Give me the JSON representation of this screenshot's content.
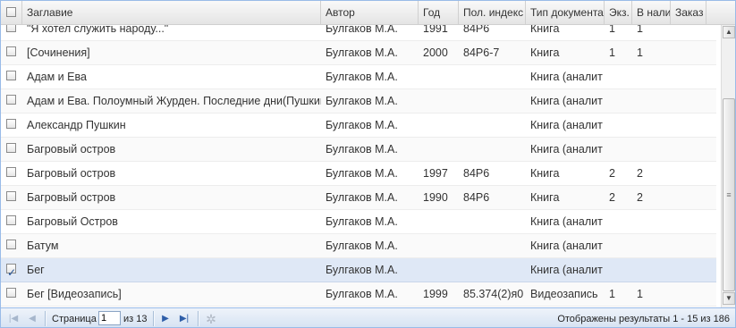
{
  "columns": [
    {
      "key": "select",
      "label": ""
    },
    {
      "key": "title",
      "label": "Заглавие"
    },
    {
      "key": "author",
      "label": "Автор"
    },
    {
      "key": "year",
      "label": "Год"
    },
    {
      "key": "index",
      "label": "Пол. индекс"
    },
    {
      "key": "doctype",
      "label": "Тип документа"
    },
    {
      "key": "copies",
      "label": "Экз."
    },
    {
      "key": "available",
      "label": "В наличии"
    },
    {
      "key": "order",
      "label": "Заказ"
    }
  ],
  "rows": [
    {
      "checked": false,
      "title": "\"Я хотел служить народу...\"",
      "author": "Булгаков М.А.",
      "year": "1991",
      "index": "84Р6",
      "doctype": "Книга",
      "copies": "1",
      "available": "1",
      "order": ""
    },
    {
      "checked": false,
      "title": "[Сочинения]",
      "author": "Булгаков М.А.",
      "year": "2000",
      "index": "84Р6-7",
      "doctype": "Книга",
      "copies": "1",
      "available": "1",
      "order": ""
    },
    {
      "checked": false,
      "title": "Адам и Ева",
      "author": "Булгаков М.А.",
      "year": "",
      "index": "",
      "doctype": "Книга (аналит",
      "copies": "",
      "available": "",
      "order": ""
    },
    {
      "checked": false,
      "title": "Адам и Ева. Полоумный Журден. Последние дни(Пушкин)",
      "author": "Булгаков М.А.",
      "year": "",
      "index": "",
      "doctype": "Книга (аналит",
      "copies": "",
      "available": "",
      "order": ""
    },
    {
      "checked": false,
      "title": "Александр Пушкин",
      "author": "Булгаков М.А.",
      "year": "",
      "index": "",
      "doctype": "Книга (аналит",
      "copies": "",
      "available": "",
      "order": ""
    },
    {
      "checked": false,
      "title": "Багровый остров",
      "author": "Булгаков М.А.",
      "year": "",
      "index": "",
      "doctype": "Книга (аналит",
      "copies": "",
      "available": "",
      "order": ""
    },
    {
      "checked": false,
      "title": "Багровый остров",
      "author": "Булгаков М.А.",
      "year": "1997",
      "index": "84Р6",
      "doctype": "Книга",
      "copies": "2",
      "available": "2",
      "order": ""
    },
    {
      "checked": false,
      "title": "Багровый остров",
      "author": "Булгаков М.А.",
      "year": "1990",
      "index": "84Р6",
      "doctype": "Книга",
      "copies": "2",
      "available": "2",
      "order": ""
    },
    {
      "checked": false,
      "title": "Багровый Остров",
      "author": "Булгаков М.А.",
      "year": "",
      "index": "",
      "doctype": "Книга (аналит",
      "copies": "",
      "available": "",
      "order": ""
    },
    {
      "checked": false,
      "title": "Батум",
      "author": "Булгаков М.А.",
      "year": "",
      "index": "",
      "doctype": "Книга (аналит",
      "copies": "",
      "available": "",
      "order": ""
    },
    {
      "checked": true,
      "title": "Бег",
      "author": "Булгаков М.А.",
      "year": "",
      "index": "",
      "doctype": "Книга (аналит",
      "copies": "",
      "available": "",
      "order": ""
    },
    {
      "checked": false,
      "title": "Бег [Видеозапись]",
      "author": "Булгаков М.А.",
      "year": "1999",
      "index": "85.374(2)я0",
      "doctype": "Видеозапись",
      "copies": "1",
      "available": "1",
      "order": ""
    }
  ],
  "pager": {
    "page_label": "Страница",
    "current_page": "1",
    "of_label": "из 13",
    "summary": "Отображены результаты 1 - 15 из 186"
  },
  "colors": {
    "selected_row": "#dfe8f6",
    "border": "#99bbe8",
    "pager_bg": "#d5e2f2"
  }
}
